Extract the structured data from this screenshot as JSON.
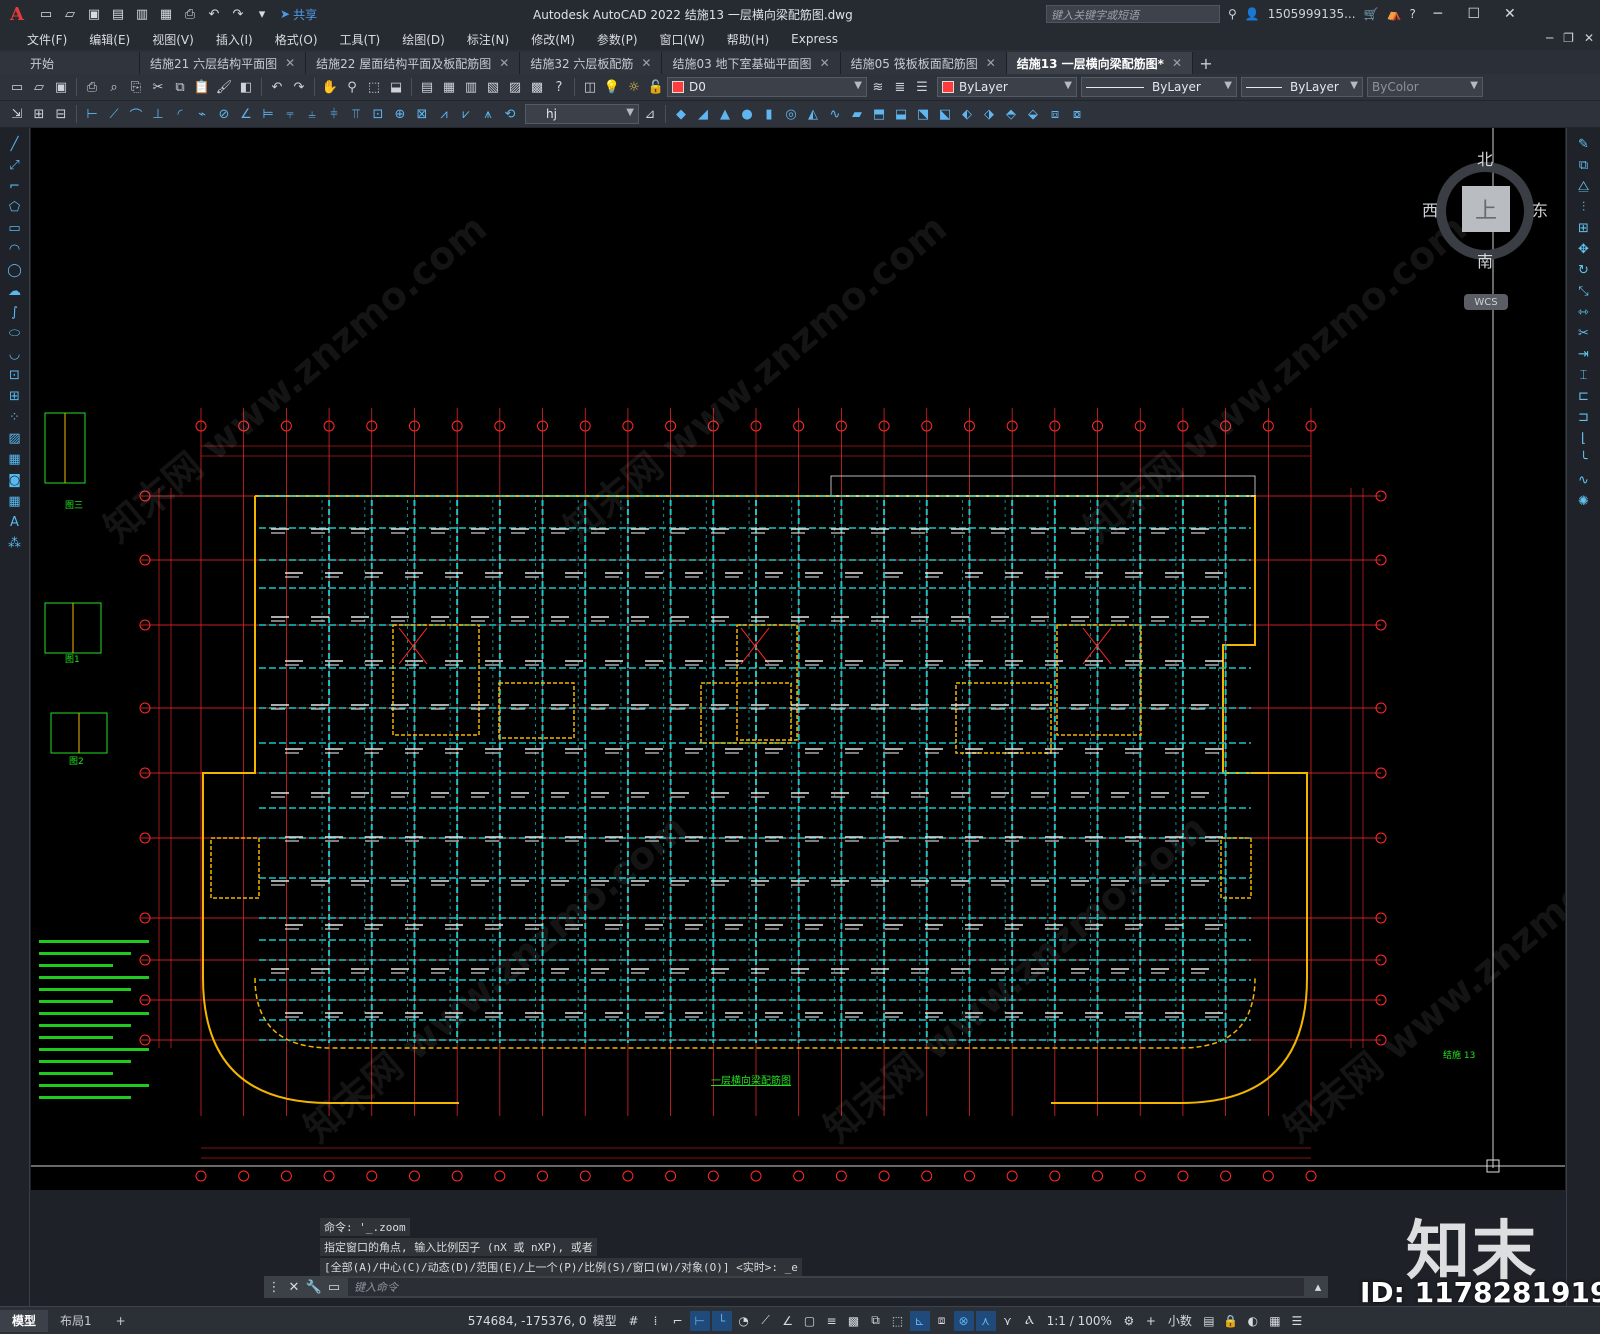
{
  "window": {
    "title": "Autodesk AutoCAD 2022    结施13 一层横向梁配筋图.dwg",
    "search_placeholder": "键入关键字或短语",
    "user": "1505999135...",
    "share_label": "共享",
    "logo_letter": "A"
  },
  "menu": [
    "文件(F)",
    "编辑(E)",
    "视图(V)",
    "插入(I)",
    "格式(O)",
    "工具(T)",
    "绘图(D)",
    "标注(N)",
    "修改(M)",
    "参数(P)",
    "窗口(W)",
    "帮助(H)",
    "Express"
  ],
  "tabs": [
    {
      "label": "开始",
      "closable": false,
      "active": false
    },
    {
      "label": "结施21 六层结构平面图",
      "closable": true,
      "active": false
    },
    {
      "label": "结施22 屋面结构平面及板配筋图",
      "closable": true,
      "active": false
    },
    {
      "label": "结施32 六层板配筋",
      "closable": true,
      "active": false
    },
    {
      "label": "结施03 地下室基础平面图",
      "closable": true,
      "active": false
    },
    {
      "label": "结施05 筏板板面配筋图",
      "closable": true,
      "active": false
    },
    {
      "label": "结施13 一层横向梁配筋图*",
      "closable": true,
      "active": true
    }
  ],
  "toolbar": {
    "layer_value": "D0",
    "color_value": "ByLayer",
    "linetype_value": "ByLayer",
    "lineweight_value": "ByLayer",
    "plotstyle_value": "ByColor",
    "textstyle_value": "hj"
  },
  "viewcube": {
    "north": "北",
    "south": "南",
    "east": "东",
    "west": "西",
    "face": "上",
    "wcs": "WCS"
  },
  "drawing": {
    "title": "一层横向梁配筋图",
    "sheet_label": "结施 13",
    "detail_labels": [
      "图三",
      "图1",
      "图2"
    ]
  },
  "command": {
    "history": [
      "命令: '_.zoom",
      "指定窗口的角点, 输入比例因子 (nX 或 nXP), 或者",
      "[全部(A)/中心(C)/动态(D)/范围(E)/上一个(P)/比例(S)/窗口(W)/对象(O)] <实时>: _e"
    ],
    "input_placeholder": "键入命令"
  },
  "status": {
    "tabs": [
      "模型",
      "布局1"
    ],
    "coords": "574684, -175376, 0",
    "space": "模型",
    "scale": "1:1 / 100%",
    "units": "小数"
  },
  "watermark": {
    "logo": "知末",
    "id": "ID: 1178281919",
    "text": "知末网 www.znzmo.com"
  },
  "colors": {
    "background": "#000000",
    "axis_red": "#ff2a2a",
    "beam_cyan": "#19c6c6",
    "wall_yellow": "#f2b600",
    "label_white": "#e6e6e6",
    "note_green": "#22e022"
  }
}
